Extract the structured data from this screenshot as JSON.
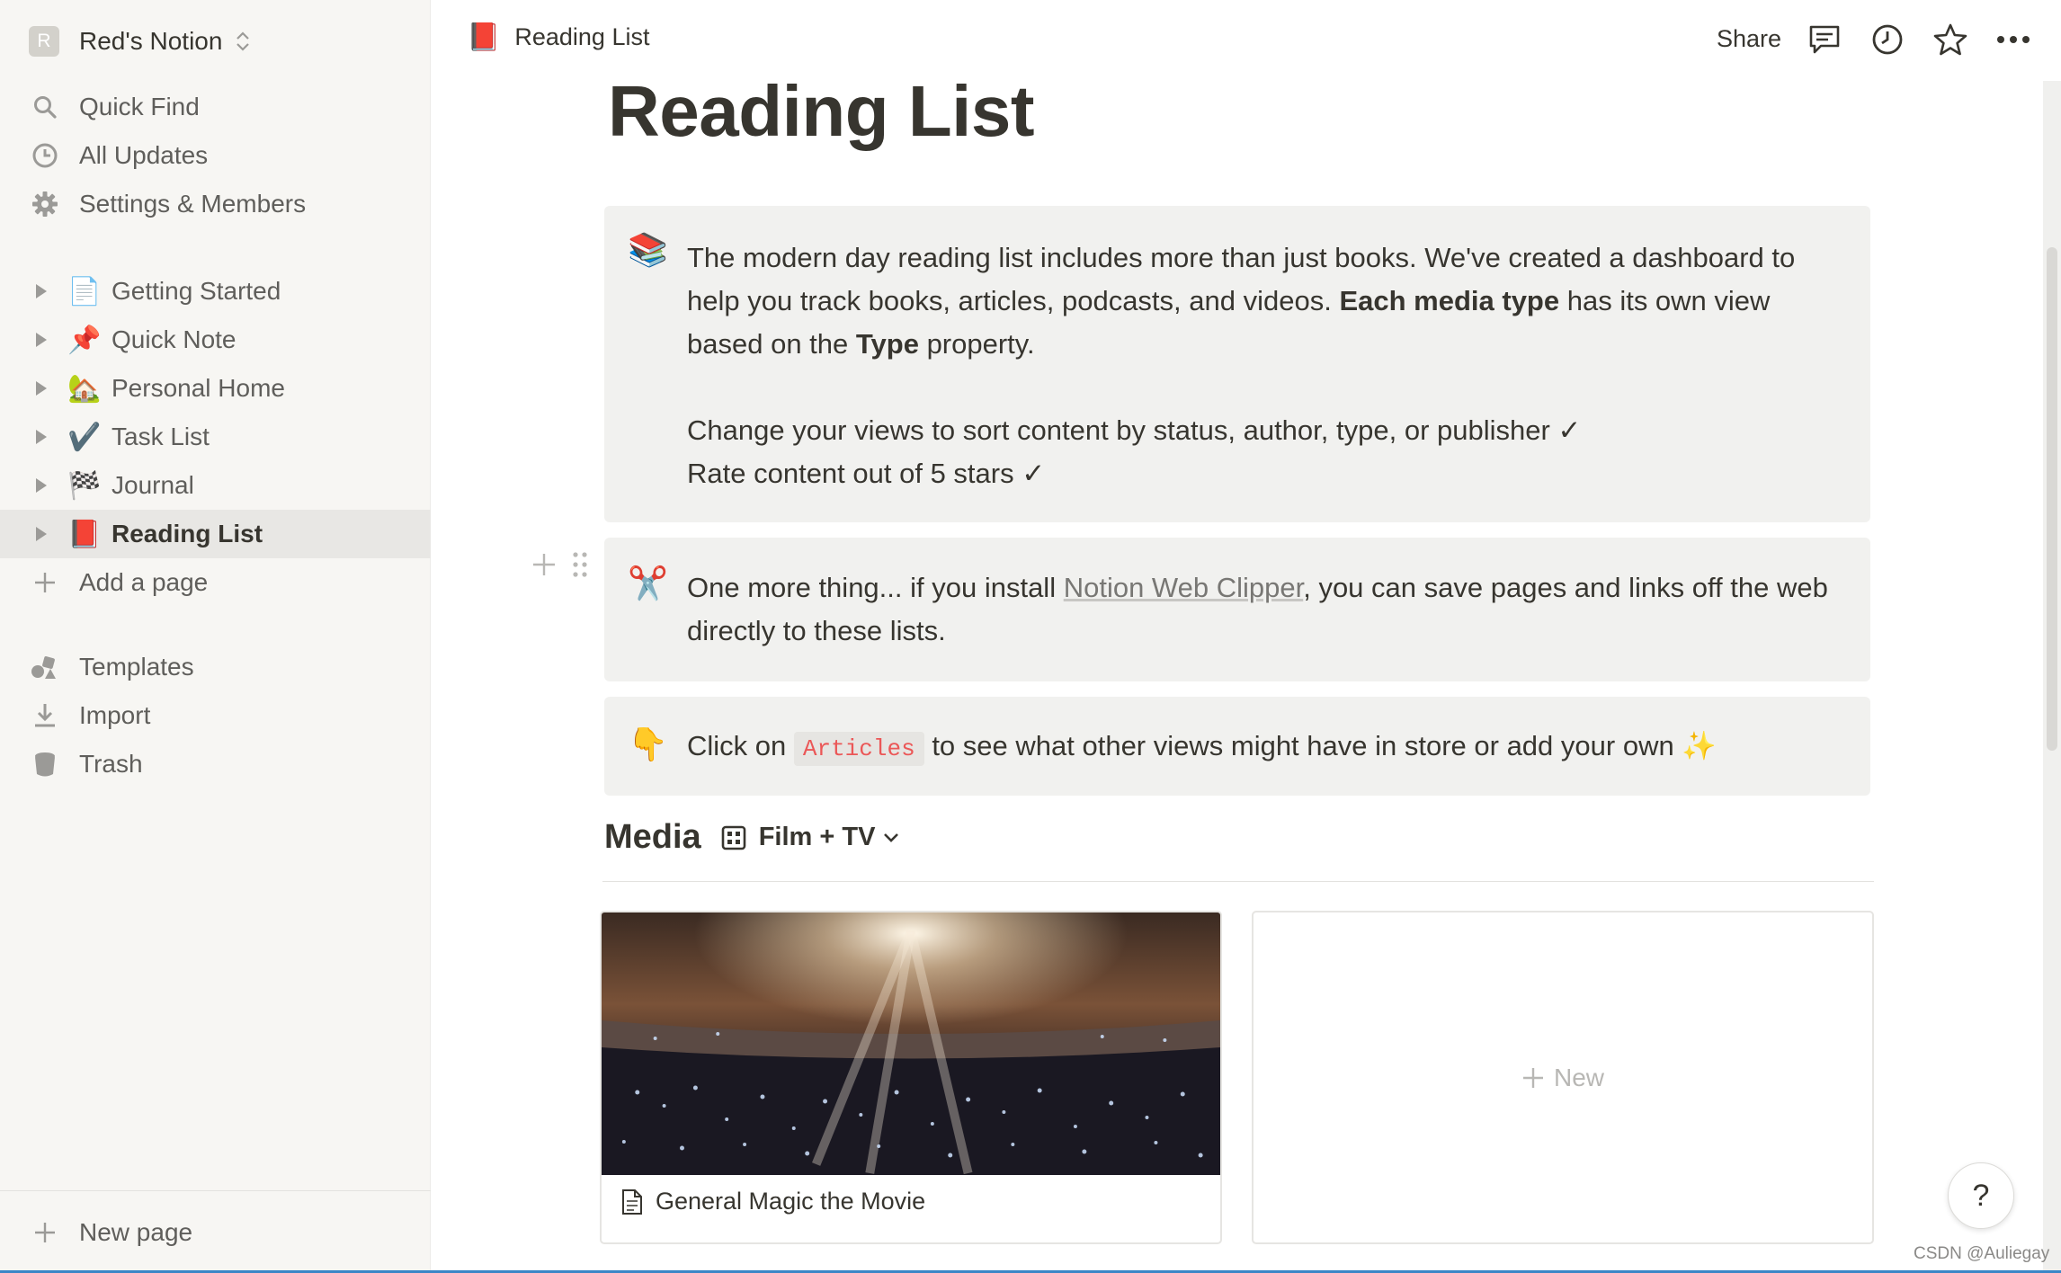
{
  "sidebar": {
    "workspace": {
      "avatar_letter": "R",
      "name": "Red's Notion"
    },
    "nav": [
      {
        "label": "Quick Find",
        "icon": "search-icon"
      },
      {
        "label": "All Updates",
        "icon": "clock-icon"
      },
      {
        "label": "Settings & Members",
        "icon": "gear-icon"
      }
    ],
    "pages": [
      {
        "label": "Getting Started",
        "emoji": "📄"
      },
      {
        "label": "Quick Note",
        "emoji": "📌"
      },
      {
        "label": "Personal Home",
        "emoji": "🏡"
      },
      {
        "label": "Task List",
        "emoji": "✔️"
      },
      {
        "label": "Journal",
        "emoji": "🏁"
      },
      {
        "label": "Reading List",
        "emoji": "📕",
        "active": true
      }
    ],
    "add_page": "Add a page",
    "tools": [
      {
        "label": "Templates",
        "icon": "templates-icon"
      },
      {
        "label": "Import",
        "icon": "import-icon"
      },
      {
        "label": "Trash",
        "icon": "trash-icon"
      }
    ],
    "new_page": "New page"
  },
  "topbar": {
    "breadcrumb_emoji": "📕",
    "breadcrumb": "Reading List",
    "share": "Share"
  },
  "page": {
    "title": "Reading List",
    "callout1": {
      "emoji": "📚",
      "line1_a": "The modern day reading list includes more than just books. We've created a dashboard to help you track books, articles, podcasts, and videos. ",
      "line1_b": "Each media type",
      "line1_c": " has its own view based on the ",
      "line1_d": "Type",
      "line1_e": " property.",
      "line2": "Change your views to sort content by status, author, type, or publisher ✓",
      "line3": "Rate content out of 5 stars ✓"
    },
    "callout2": {
      "emoji": "✂️",
      "text_a": "One more thing... if you install ",
      "link": "Notion Web Clipper",
      "text_b": ", you can save pages and links off the web directly to these lists."
    },
    "callout3": {
      "emoji": "👇",
      "text_a": "Click on ",
      "code": "Articles",
      "text_b": " to see what other views might have in store or add your own ✨"
    },
    "media": {
      "title": "Media",
      "view": "Film + TV",
      "cards": [
        {
          "title": "General Magic the Movie"
        }
      ],
      "new_label": "New"
    }
  },
  "help": "?",
  "watermark": "CSDN @Auliegay",
  "colors": {
    "sidebar_bg": "#f7f6f3",
    "callout_bg": "#f1f1ef",
    "code_red": "#eb5757",
    "text": "#37352f"
  }
}
